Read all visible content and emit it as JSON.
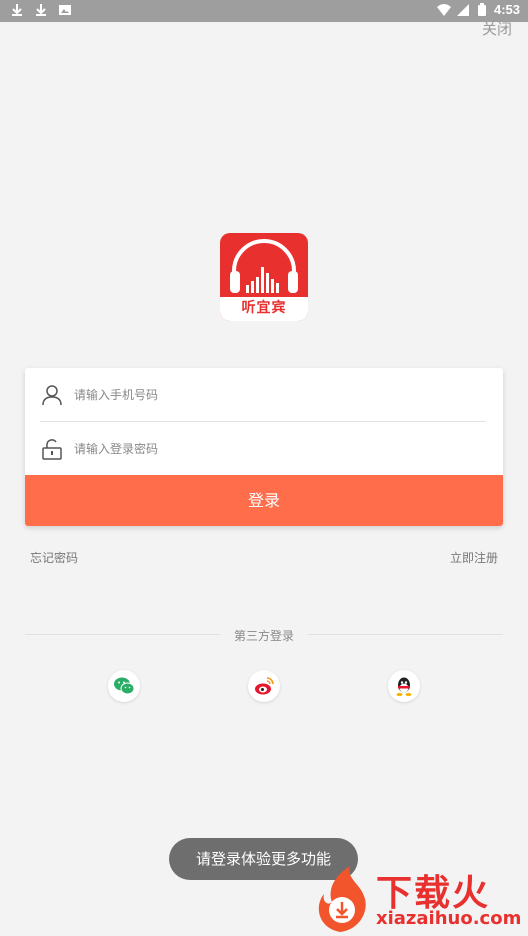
{
  "status_bar": {
    "time": "4:53",
    "left_icons": [
      "download-icon",
      "download-icon",
      "image-icon"
    ],
    "right_icons": [
      "wifi-icon",
      "signal-icon",
      "battery-icon"
    ]
  },
  "header": {
    "close_label": "关闭"
  },
  "app": {
    "logo_text": "听宜宾",
    "brand_color": "#e8312f"
  },
  "form": {
    "phone_placeholder": "请输入手机号码",
    "password_placeholder": "请输入登录密码",
    "login_label": "登录",
    "button_color": "#ff6d4b"
  },
  "links": {
    "forgot_password": "忘记密码",
    "register": "立即注册"
  },
  "third_party": {
    "label": "第三方登录",
    "providers": [
      "wechat-icon",
      "weibo-icon",
      "qq-icon"
    ]
  },
  "toast": {
    "message": "请登录体验更多功能"
  },
  "watermark": {
    "title": "下载火",
    "url": "xiazaihuo.com"
  }
}
